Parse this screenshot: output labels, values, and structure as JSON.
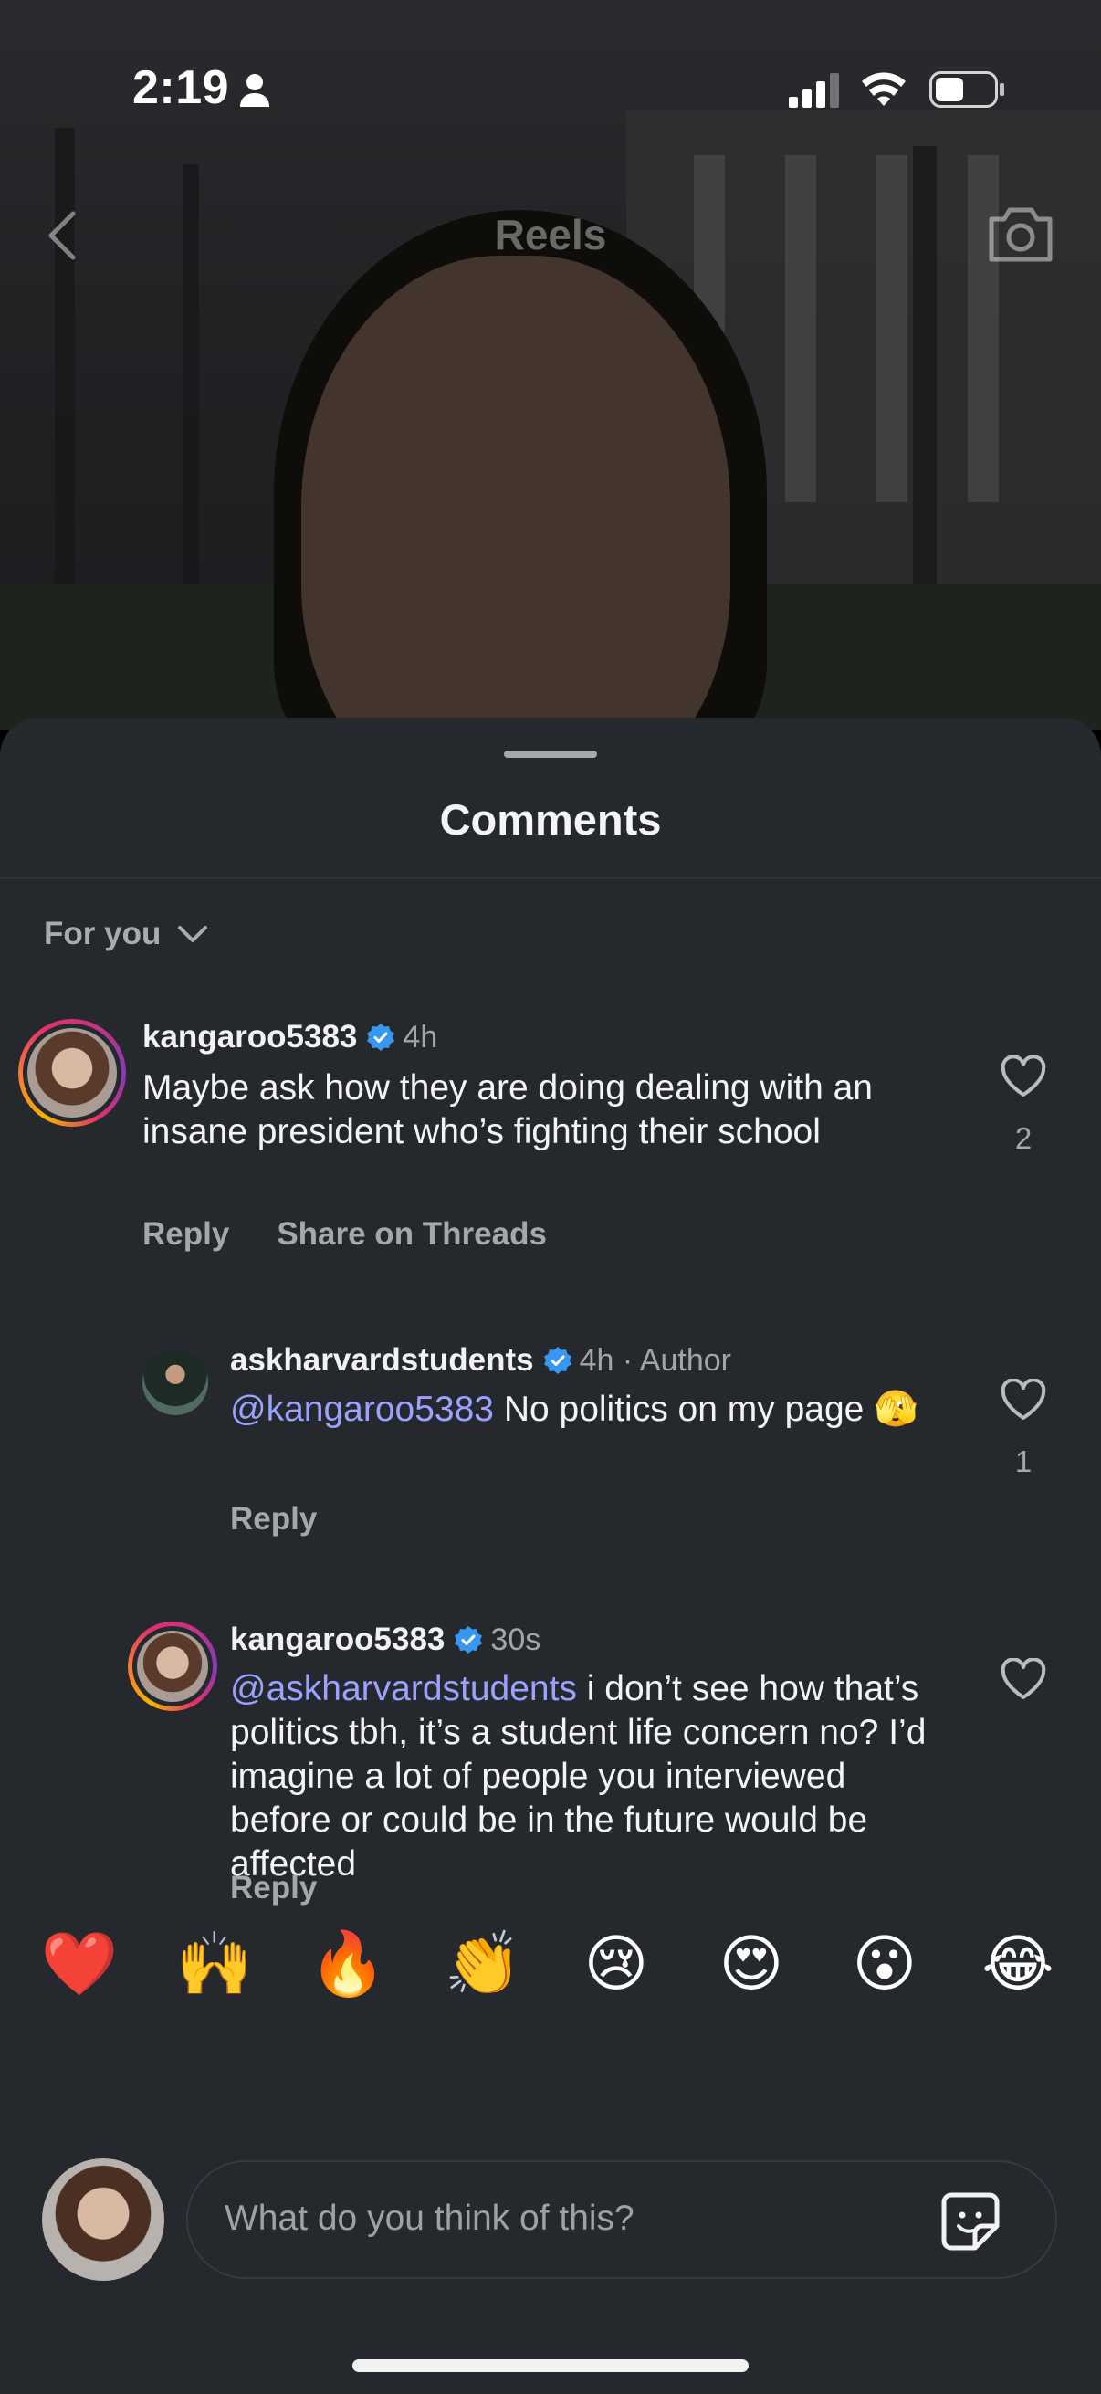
{
  "status_bar": {
    "time": "2:19"
  },
  "header": {
    "title": "Reels"
  },
  "sheet": {
    "title": "Comments",
    "filter_label": "For you"
  },
  "comments": [
    {
      "username": "kangaroo5383",
      "time": "4h",
      "text": "Maybe ask how they are doing dealing with an insane president who’s fighting their school",
      "reply_label": "Reply",
      "share_label": "Share on Threads",
      "likes": "2"
    },
    {
      "username": "askharvardstudents",
      "time": "4h · Author",
      "mention": "@kangaroo5383",
      "text": " No politics on my page 🫣",
      "reply_label": "Reply",
      "likes": "1"
    },
    {
      "username": "kangaroo5383",
      "time": "30s",
      "mention": "@askharvardstudents",
      "text": " i don’t see how that’s politics tbh, it’s a student life concern no?  I’d imagine a lot of people you interviewed before or could be in the future would be affected",
      "reply_label": "Reply",
      "likes": ""
    }
  ],
  "emoji_bar": [
    "❤️",
    "🙌",
    "🔥",
    "👏",
    "😢",
    "😍",
    "😮",
    "😂"
  ],
  "composer": {
    "placeholder": "What do you think of this?"
  },
  "colors": {
    "sheet_bg": "#25282d",
    "mention": "#9aa1ff",
    "verified": "#3897f0"
  }
}
